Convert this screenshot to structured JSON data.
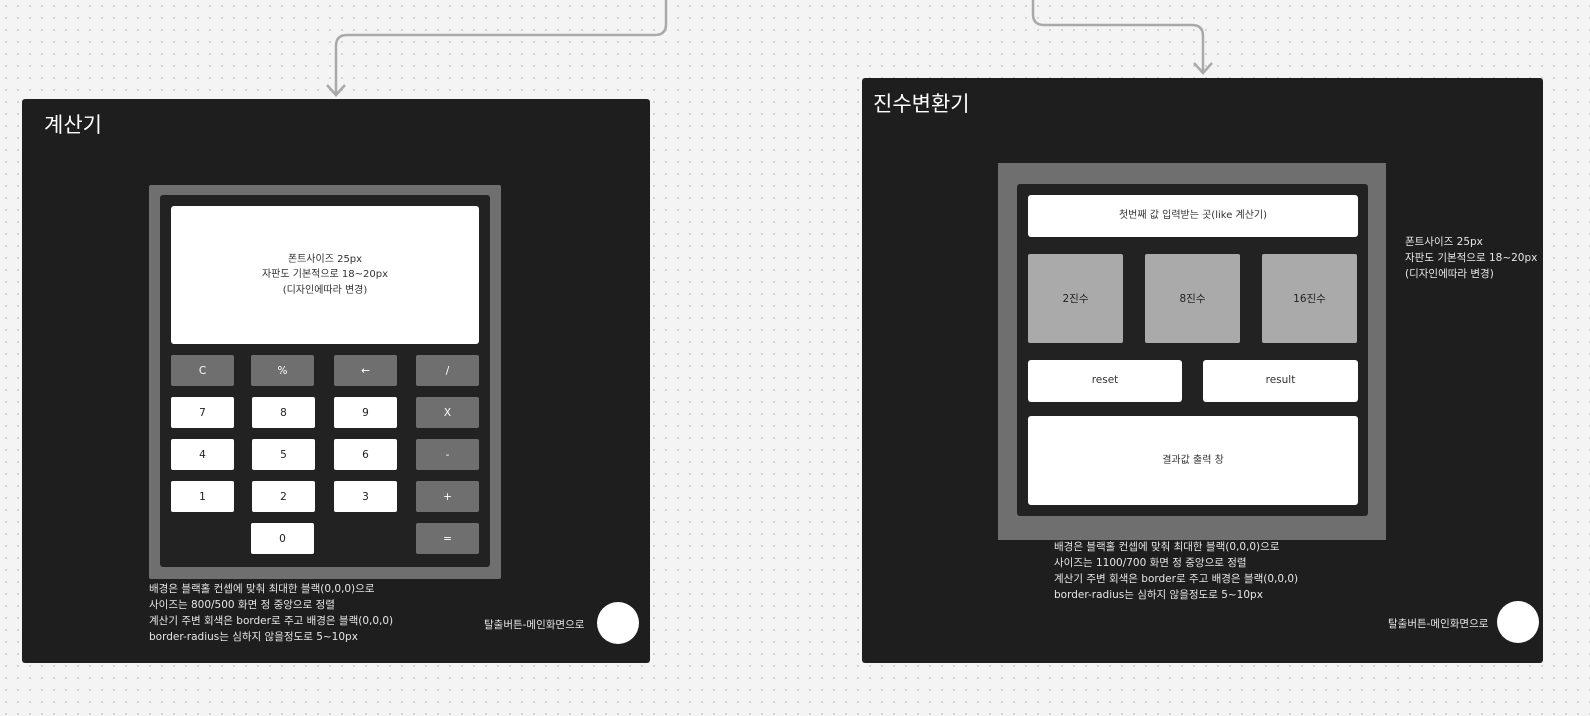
{
  "calculator": {
    "title": "계산기",
    "display_lines": [
      "폰트사이즈 25px",
      "자판도 기본적으로 18~20px",
      "(디자인에따라 변경)"
    ],
    "keys": [
      "C",
      "%",
      "←",
      "/",
      "7",
      "8",
      "9",
      "X",
      "4",
      "5",
      "6",
      "-",
      "1",
      "2",
      "3",
      "+",
      "0",
      "="
    ],
    "notes": [
      "배경은 블랙홀 컨셉에 맞춰 최대한 블랙(0,0,0)으로",
      "사이즈는 800/500 화면 정 중앙으로 정렬",
      "계산기 주변 회색은 border로 주고 배경은 블랙(0,0,0)",
      "border-radius는 심하지 않을정도로 5~10px"
    ],
    "exit_label": "탈출버튼-메인화면으로"
  },
  "converter": {
    "title": "진수변환기",
    "input_placeholder": "첫번째 값 입력받는 곳(like 계산기)",
    "base_buttons": [
      "2진수",
      "8진수",
      "16진수"
    ],
    "reset_label": "reset",
    "result_label": "result",
    "output_label": "결과값 출력 창",
    "side_notes": [
      "폰트사이즈 25px",
      "자판도 기본적으로 18~20px",
      "(디자인에따라 변경)"
    ],
    "notes": [
      "배경은 블랙홀 컨셉에 맞춰 최대한 블랙(0,0,0)으로",
      "사이즈는 1100/700 화면 정 중앙으로 정렬",
      "계산기 주변 회색은 border로 주고 배경은 블랙(0,0,0)",
      "border-radius는 심하지 않을정도로 5~10px"
    ],
    "exit_label": "탈출버튼-메인화면으로"
  }
}
